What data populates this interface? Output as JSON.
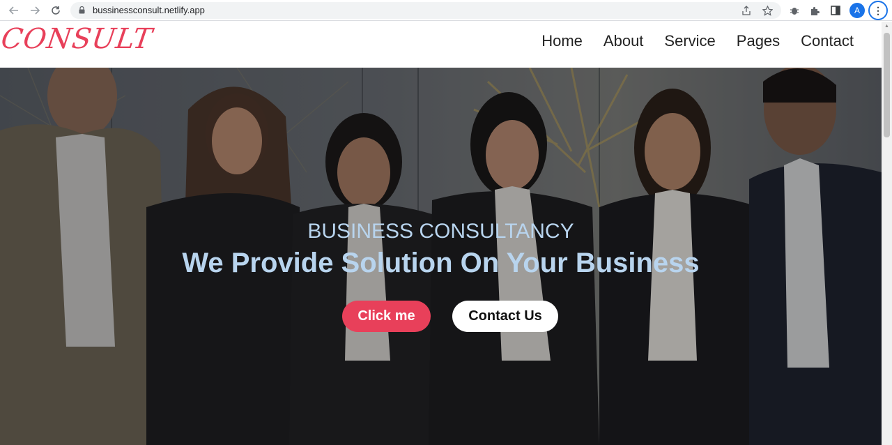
{
  "browser": {
    "url": "bussinessconsult.netlify.app",
    "back_icon": "arrow-left-icon",
    "forward_icon": "arrow-right-icon",
    "reload_icon": "reload-icon",
    "avatar_letter": "A"
  },
  "site": {
    "logo": "CONSULT",
    "nav": [
      "Home",
      "About",
      "Service",
      "Pages",
      "Contact"
    ]
  },
  "hero": {
    "subtitle": "BUSINESS CONSULTANCY",
    "title": "We Provide Solution On Your Business",
    "primary_button": "Click me",
    "secondary_button": "Contact Us"
  },
  "colors": {
    "brand": "#e8405a",
    "hero_text": "#b8d4ee"
  }
}
